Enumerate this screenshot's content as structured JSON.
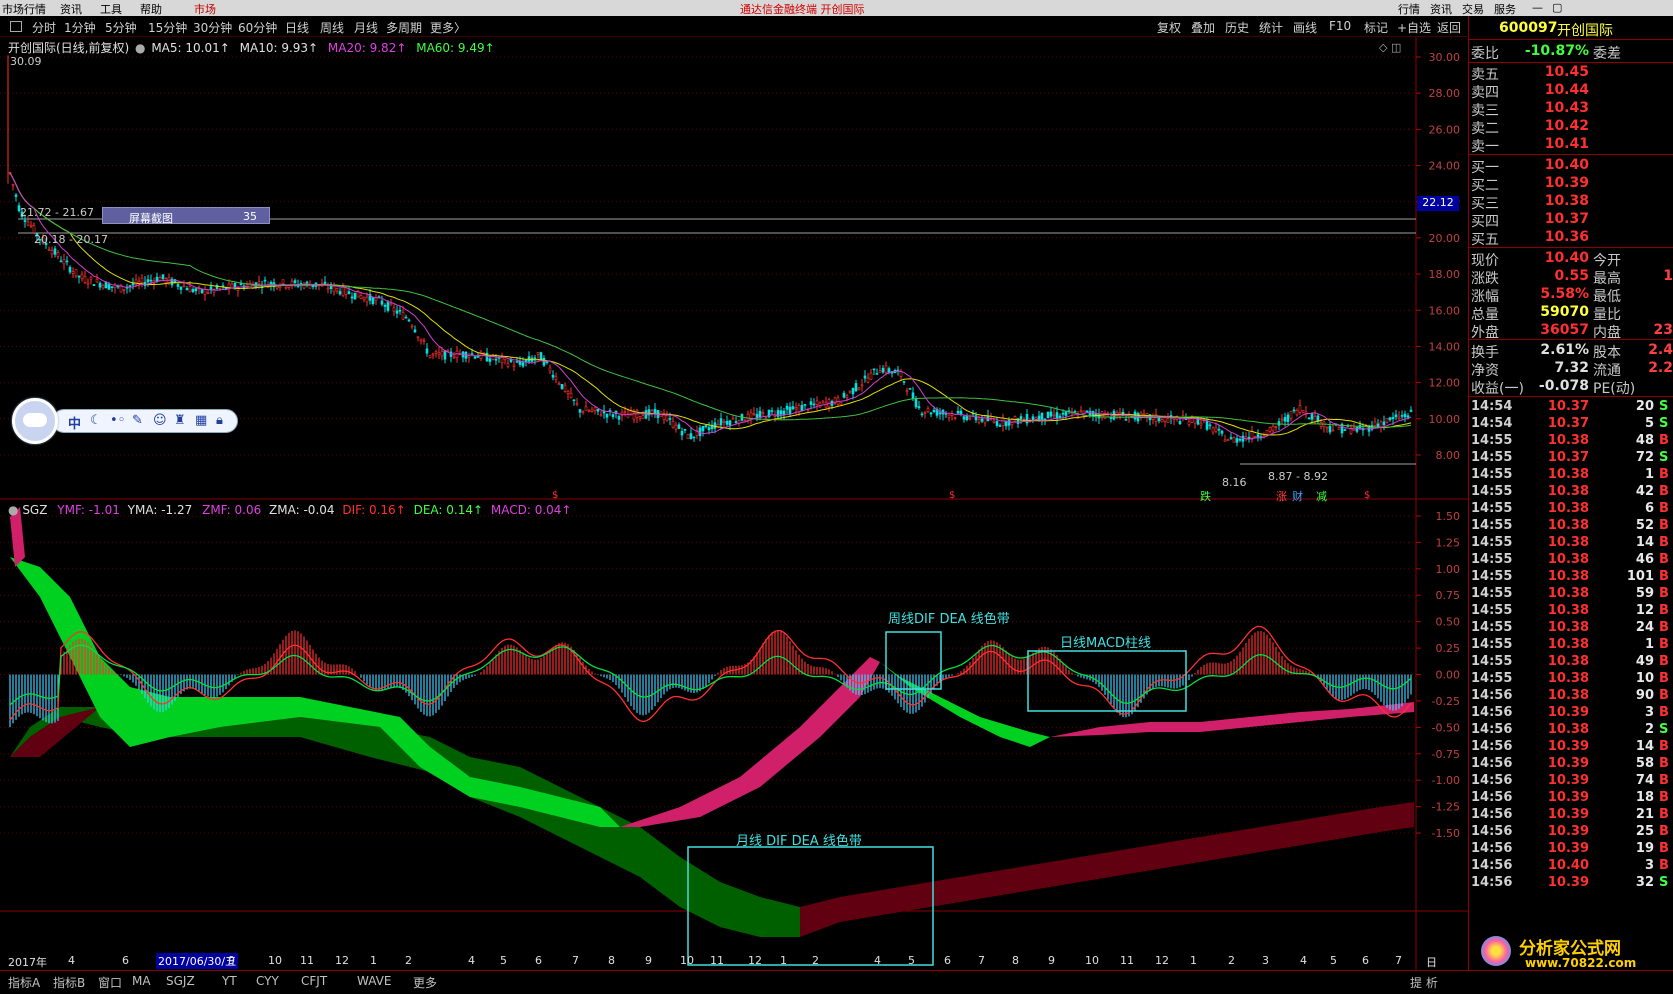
{
  "topmenu": {
    "items": [
      "市场行情",
      "资讯",
      "工具",
      "帮助",
      "市场"
    ],
    "center_title": "通达信金融终端  开创国际",
    "right_items": [
      "行情",
      "资讯",
      "交易",
      "服务"
    ]
  },
  "toolbar": {
    "periods": [
      "分时",
      "1分钟",
      "5分钟",
      "15分钟",
      "30分钟",
      "60分钟",
      "日线",
      "周线",
      "月线",
      "多周期",
      "更多〉"
    ],
    "right_items": [
      "复权",
      "叠加",
      "历史",
      "统计",
      "画线",
      "F10",
      "标记",
      "+自选",
      "返回"
    ]
  },
  "main_chart": {
    "title": "开创国际(日线,前复权)",
    "ma5": "MA5: 10.01↑",
    "ma10": "MA10: 9.93↑",
    "ma20": "MA20: 9.82↑",
    "ma60": "MA60: 9.49↑",
    "hi_label": "30.09",
    "range_label_1": "21.72 - 21.67",
    "range_label_2": "20.18 - 20.17",
    "low_label": "8.16",
    "range_label_3": "8.87 - 8.92",
    "screenshot_label": "屏幕截图",
    "screenshot_num": "35",
    "price_tag": "22.12",
    "event_marks": [
      "跌",
      "涨",
      "财",
      "减"
    ],
    "s_mark": "$",
    "yaxis": [
      "30.00",
      "28.00",
      "26.00",
      "24.00",
      "22.00",
      "20.00",
      "18.00",
      "16.00",
      "14.00",
      "12.00",
      "10.00",
      "8.00"
    ]
  },
  "indicator": {
    "name": "SGZ",
    "ymf": "YMF: -1.01",
    "yma": "YMA: -1.27",
    "zmf": "ZMF: 0.06",
    "zma": "ZMA: -0.04",
    "dif": "DIF: 0.16↑",
    "dea": "DEA: 0.14↑",
    "macd": "MACD: 0.04↑",
    "yaxis": [
      "1.50",
      "1.25",
      "1.00",
      "0.75",
      "0.50",
      "0.25",
      "0.00",
      "-0.25",
      "-0.50",
      "-0.75",
      "-1.00",
      "-1.25",
      "-1.50"
    ],
    "annot_week": "周线DIF  DEA 线色带",
    "annot_daymacd": "日线MACD柱线",
    "annot_month": "月线 DIF DEA 线色带"
  },
  "xaxis": {
    "year_label": "2017年",
    "cursor_date": "2017/06/30/五",
    "ticks": [
      "4",
      "6",
      "9",
      "10",
      "11",
      "12",
      "1",
      "2",
      "4",
      "5",
      "6",
      "7",
      "8",
      "9",
      "10",
      "11",
      "12",
      "1",
      "2",
      "4",
      "5",
      "6",
      "7",
      "8",
      "9",
      "10",
      "11",
      "12",
      "1",
      "2",
      "3",
      "4",
      "5",
      "6",
      "7"
    ],
    "period": "日线"
  },
  "quote": {
    "code": "600097",
    "name": "开创国际",
    "wb_label": "委比",
    "wb_value": "-10.87%",
    "wc_label": "委差",
    "asks": [
      {
        "label": "卖五",
        "price": "10.45"
      },
      {
        "label": "卖四",
        "price": "10.44"
      },
      {
        "label": "卖三",
        "price": "10.43"
      },
      {
        "label": "卖二",
        "price": "10.42"
      },
      {
        "label": "卖一",
        "price": "10.41"
      }
    ],
    "bids": [
      {
        "label": "买一",
        "price": "10.40"
      },
      {
        "label": "买二",
        "price": "10.39"
      },
      {
        "label": "买三",
        "price": "10.38"
      },
      {
        "label": "买四",
        "price": "10.37"
      },
      {
        "label": "买五",
        "price": "10.36"
      }
    ],
    "stats": [
      {
        "l": "现价",
        "v": "10.40",
        "c": "#ff3030",
        "l2": "今开",
        "v2": ""
      },
      {
        "l": "涨跌",
        "v": "0.55",
        "c": "#ff3030",
        "l2": "最高",
        "v2": "1"
      },
      {
        "l": "涨幅",
        "v": "5.58%",
        "c": "#ff3030",
        "l2": "最低",
        "v2": ""
      },
      {
        "l": "总量",
        "v": "59070",
        "c": "#ffff40",
        "l2": "量比",
        "v2": ""
      },
      {
        "l": "外盘",
        "v": "36057",
        "c": "#ff3030",
        "l2": "内盘",
        "v2": "23"
      },
      {
        "l": "换手",
        "v": "2.61%",
        "c": "#e0e0e0",
        "l2": "股本",
        "v2": "2.4"
      },
      {
        "l": "净资",
        "v": "7.32",
        "c": "#e0e0e0",
        "l2": "流通",
        "v2": "2.2"
      },
      {
        "l": "收益(一)",
        "v": "-0.078",
        "c": "#e0e0e0",
        "l2": "PE(动)",
        "v2": ""
      }
    ],
    "ticks": [
      {
        "t": "14:54",
        "p": "10.37",
        "q": "20",
        "d": "S"
      },
      {
        "t": "14:54",
        "p": "10.37",
        "q": "5",
        "d": "S"
      },
      {
        "t": "14:55",
        "p": "10.38",
        "q": "48",
        "d": "B"
      },
      {
        "t": "14:55",
        "p": "10.37",
        "q": "72",
        "d": "S"
      },
      {
        "t": "14:55",
        "p": "10.38",
        "q": "1",
        "d": "B"
      },
      {
        "t": "14:55",
        "p": "10.38",
        "q": "42",
        "d": "B"
      },
      {
        "t": "14:55",
        "p": "10.38",
        "q": "6",
        "d": "B"
      },
      {
        "t": "14:55",
        "p": "10.38",
        "q": "52",
        "d": "B"
      },
      {
        "t": "14:55",
        "p": "10.38",
        "q": "14",
        "d": "B"
      },
      {
        "t": "14:55",
        "p": "10.38",
        "q": "46",
        "d": "B"
      },
      {
        "t": "14:55",
        "p": "10.38",
        "q": "101",
        "d": "B"
      },
      {
        "t": "14:55",
        "p": "10.38",
        "q": "59",
        "d": "B"
      },
      {
        "t": "14:55",
        "p": "10.38",
        "q": "12",
        "d": "B"
      },
      {
        "t": "14:55",
        "p": "10.38",
        "q": "24",
        "d": "B"
      },
      {
        "t": "14:55",
        "p": "10.38",
        "q": "1",
        "d": "B"
      },
      {
        "t": "14:55",
        "p": "10.38",
        "q": "49",
        "d": "B"
      },
      {
        "t": "14:55",
        "p": "10.38",
        "q": "10",
        "d": "B"
      },
      {
        "t": "14:56",
        "p": "10.38",
        "q": "90",
        "d": "B"
      },
      {
        "t": "14:56",
        "p": "10.39",
        "q": "3",
        "d": "B"
      },
      {
        "t": "14:56",
        "p": "10.38",
        "q": "2",
        "d": "S"
      },
      {
        "t": "14:56",
        "p": "10.39",
        "q": "14",
        "d": "B"
      },
      {
        "t": "14:56",
        "p": "10.39",
        "q": "58",
        "d": "B"
      },
      {
        "t": "14:56",
        "p": "10.39",
        "q": "74",
        "d": "B"
      },
      {
        "t": "14:56",
        "p": "10.39",
        "q": "18",
        "d": "B"
      },
      {
        "t": "14:56",
        "p": "10.39",
        "q": "21",
        "d": "B"
      },
      {
        "t": "14:56",
        "p": "10.39",
        "q": "25",
        "d": "B"
      },
      {
        "t": "14:56",
        "p": "10.39",
        "q": "19",
        "d": "B"
      },
      {
        "t": "14:56",
        "p": "10.40",
        "q": "3",
        "d": "B"
      },
      {
        "t": "14:56",
        "p": "10.39",
        "q": "32",
        "d": "S"
      }
    ]
  },
  "float_toolbar": {
    "lang": "中"
  },
  "statusbar": {
    "tabs": [
      "指标A",
      "指标B",
      "窗口",
      "MA",
      "SGJZ",
      "YT",
      "CYY",
      "CFJT",
      "WAVE",
      "更多"
    ],
    "right": "提 析"
  },
  "logo": {
    "text": "分析家公式网",
    "url": "www.70822.com"
  },
  "colors": {
    "up": "#ff3030",
    "down": "#00c8ff",
    "green": "#00ff40",
    "magenta": "#d0206a",
    "bg": "#000000",
    "grid": "#8b0000"
  }
}
